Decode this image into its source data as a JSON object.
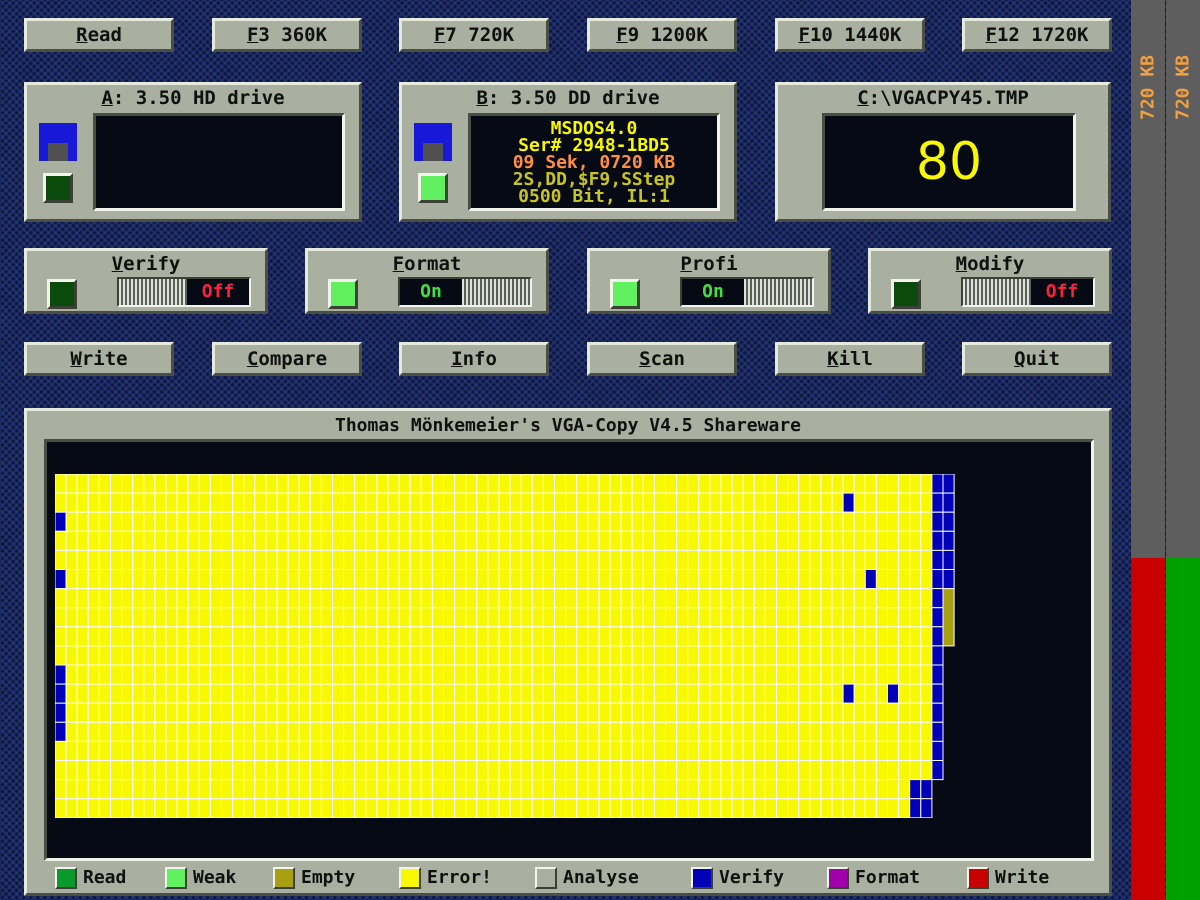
{
  "top_buttons": [
    {
      "hotkey": "R",
      "rest": "ead"
    },
    {
      "hotkey": "F",
      "rest": "3 360K"
    },
    {
      "hotkey": "F",
      "rest": "7 720K"
    },
    {
      "hotkey": "F",
      "rest": "9 1200K"
    },
    {
      "hotkey": "F",
      "rest": "10 1440K"
    },
    {
      "hotkey": "F",
      "rest": "12 1720K"
    }
  ],
  "drive_a": {
    "hotkey": "A",
    "rest": ": 3.50 HD drive",
    "icon": "floppy-disk-icon"
  },
  "drive_b": {
    "hotkey": "B",
    "rest": ": 3.50 DD drive",
    "icon": "floppy-disk-icon",
    "info_lines": [
      {
        "text": "MSDOS4.0",
        "color": "#f8f800"
      },
      {
        "text": "Ser# 2948-1BD5",
        "color": "#f8f800"
      },
      {
        "text": "09 Sek, 0720 KB",
        "color": "#ff9040"
      },
      {
        "text": "2S,DD,$F9,SStep",
        "color": "#c8c420"
      },
      {
        "text": "0500 Bit, IL:1",
        "color": "#c8c420"
      }
    ]
  },
  "drive_c": {
    "hotkey": "C",
    "rest": ":\\VGACPY45.TMP",
    "track": "80"
  },
  "options": [
    {
      "hotkey": "V",
      "rest": "erify",
      "state": "Off",
      "led": "#0a4a0a"
    },
    {
      "hotkey": "F",
      "rest": "ormat",
      "state": "On",
      "led": "#60f060"
    },
    {
      "hotkey": "P",
      "rest": "rofi",
      "state": "On",
      "led": "#60f060"
    },
    {
      "hotkey": "M",
      "rest": "odify",
      "state": "Off",
      "led": "#0a4a0a"
    }
  ],
  "action_buttons": [
    {
      "hotkey": "W",
      "rest": "rite"
    },
    {
      "hotkey": "C",
      "rest": "ompare"
    },
    {
      "hotkey": "I",
      "rest": "nfo"
    },
    {
      "hotkey": "S",
      "rest": "can"
    },
    {
      "hotkey": "K",
      "rest": "ill"
    },
    {
      "hotkey": "Q",
      "rest": "uit"
    }
  ],
  "main_title": "Thomas Mönkemeier's VGA-Copy V4.5 Shareware",
  "legend": [
    {
      "label": "Read",
      "color": "#0a9a2a"
    },
    {
      "label": "Weak",
      "color": "#60f060"
    },
    {
      "label": "Empty",
      "color": "#a8a010"
    },
    {
      "label": "Error!",
      "color": "#f8f800"
    },
    {
      "label": "Analyse",
      "color": "#aab0a0"
    },
    {
      "label": "Verify",
      "color": "#0000b8"
    },
    {
      "label": "Format",
      "color": "#a000a8"
    },
    {
      "label": "Write",
      "color": "#c80000"
    }
  ],
  "meters": [
    {
      "label": "720 KB",
      "fill_fraction": 0.38,
      "bar_color": "#c80000"
    },
    {
      "label": "720 KB",
      "fill_fraction": 0.38,
      "bar_color": "#00a000"
    }
  ],
  "colors": {
    "error": "#f8f800",
    "verify": "#0000b8",
    "empty": "#a8a010"
  }
}
